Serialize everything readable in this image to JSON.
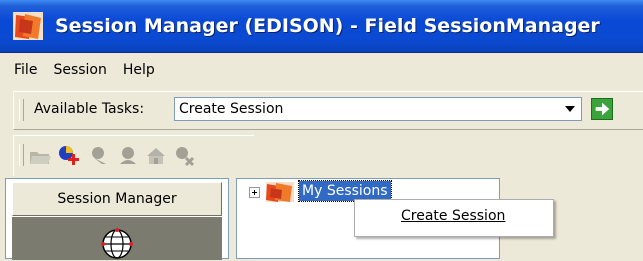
{
  "window": {
    "title": "Session Manager (EDISON) - Field SessionManager"
  },
  "menu": {
    "items": [
      {
        "label": "File"
      },
      {
        "label": "Session"
      },
      {
        "label": "Help"
      }
    ]
  },
  "tasks": {
    "label": "Available Tasks:",
    "selected": "Create Session",
    "go_icon": "green-arrow-right-icon"
  },
  "toolbar": {
    "icons": [
      "open-folder-icon",
      "add-session-icon",
      "person-icon",
      "group-icon",
      "home-network-icon",
      "remove-person-icon"
    ]
  },
  "left_pane": {
    "header": "Session Manager",
    "icon": "globe-network-icon"
  },
  "tree": {
    "root_label": "My Sessions",
    "root_icon": "session-folder-icon"
  },
  "context_menu": {
    "items": [
      {
        "label": "Create Session"
      }
    ]
  },
  "colors": {
    "titlebar": "#0a49d6",
    "window_bg": "#ece9d8",
    "selection": "#316ac5",
    "go_button": "#3aa33a"
  }
}
